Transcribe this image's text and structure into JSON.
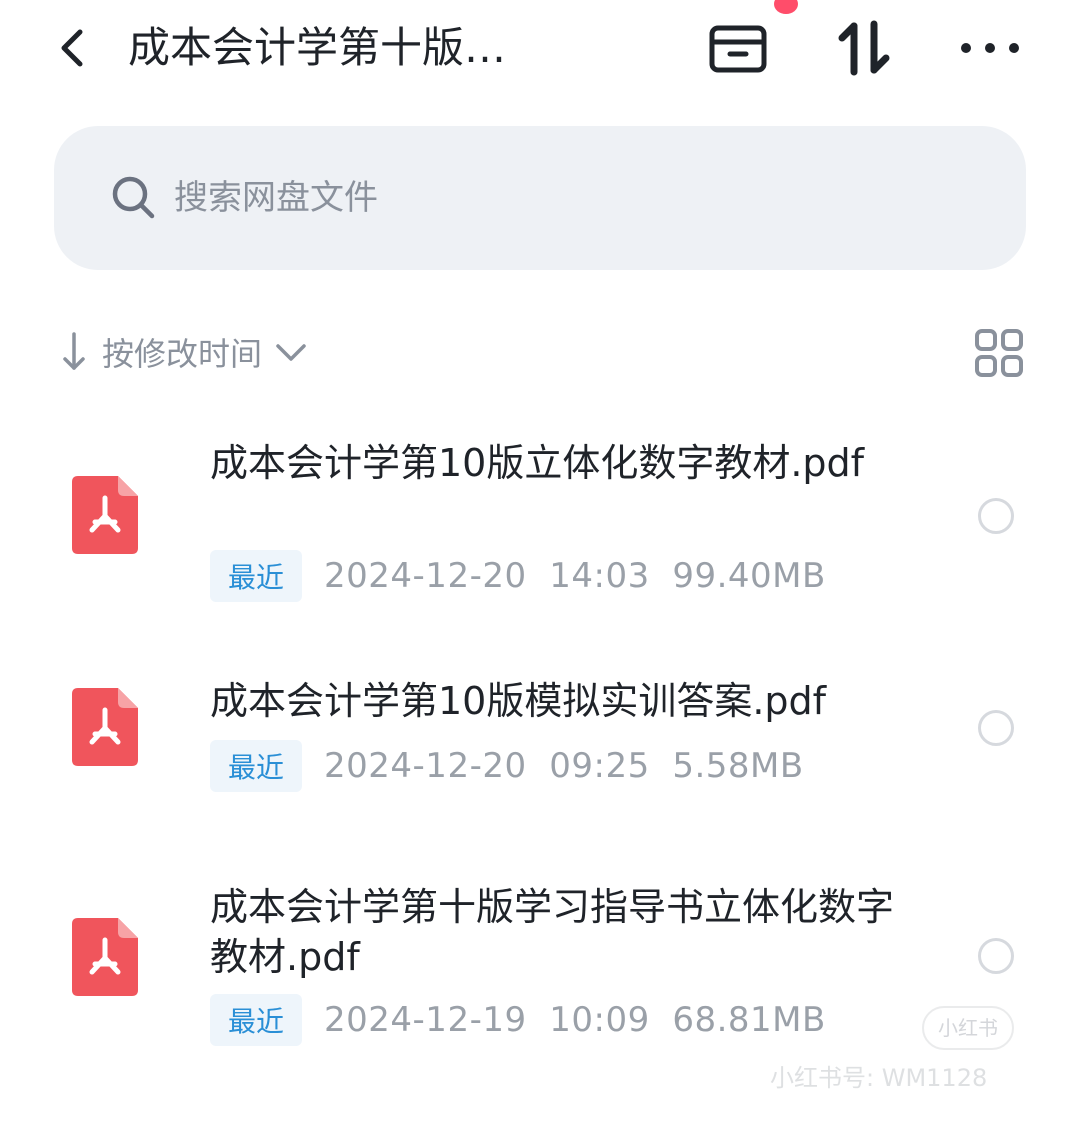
{
  "header": {
    "title": "成本会计学第十版…",
    "back_icon": "chevron-left-icon",
    "archive_icon": "archive-box-icon",
    "sort_icon": "sort-arrows-icon",
    "more_icon": "more-horizontal-icon",
    "notify_color": "#ff4d6a"
  },
  "search": {
    "placeholder": "搜索网盘文件",
    "icon": "search-icon"
  },
  "sortbar": {
    "label": "按修改时间",
    "arrow_icon": "arrow-down-icon",
    "chevron_icon": "chevron-down-icon",
    "view_icon": "grid-view-icon"
  },
  "files": [
    {
      "name": "成本会计学第10版立体化数字教材.pdf",
      "badge": "最近",
      "meta": "2024-12-20  14:03  99.40MB",
      "icon": "pdf-icon"
    },
    {
      "name": "成本会计学第10版模拟实训答案.pdf",
      "badge": "最近",
      "meta": "2024-12-20  09:25  5.58MB",
      "icon": "pdf-icon"
    },
    {
      "name": "成本会计学第十版学习指导书立体化数字教材.pdf",
      "badge": "最近",
      "meta": "2024-12-19  10:09  68.81MB",
      "icon": "pdf-icon"
    }
  ],
  "watermark": {
    "logo_text": "小红书",
    "text": "小红书号: WM1128"
  },
  "colors": {
    "pdf": "#f0555c",
    "badge_text": "#2a8fd6",
    "muted": "#9aa0a8"
  }
}
